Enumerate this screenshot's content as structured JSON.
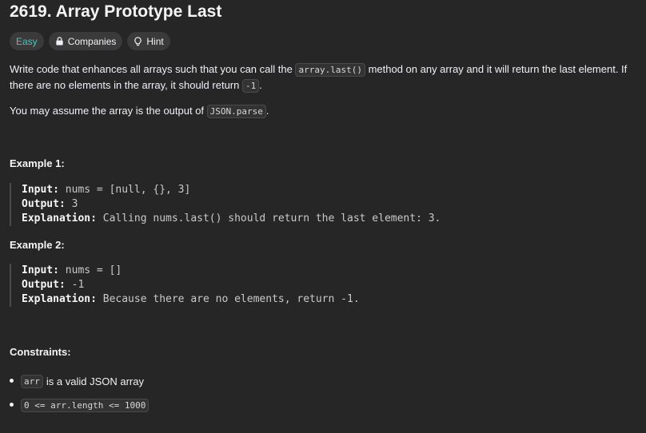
{
  "problem": {
    "title": "2619. Array Prototype Last"
  },
  "tags": {
    "difficulty": "Easy",
    "companies": "Companies",
    "hint": "Hint"
  },
  "description": {
    "p1_before": "Write code that enhances all arrays such that you can call the ",
    "p1_code": "array.last()",
    "p1_mid": " method on any array and it will return the last element. If there are no elements in the array, it should return ",
    "p1_code2": "-1",
    "p1_end": ".",
    "p2_before": "You may assume the array is the output of ",
    "p2_code": "JSON.parse",
    "p2_end": "."
  },
  "examples": [
    {
      "heading": "Example 1:",
      "input_label": "Input:",
      "input_value": " nums = [null, {}, 3]",
      "output_label": "Output:",
      "output_value": " 3",
      "explanation_label": "Explanation:",
      "explanation_value": " Calling nums.last() should return the last element: 3."
    },
    {
      "heading": "Example 2:",
      "input_label": "Input:",
      "input_value": " nums = []",
      "output_label": "Output:",
      "output_value": " -1",
      "explanation_label": "Explanation:",
      "explanation_value": " Because there are no elements, return -1."
    }
  ],
  "constraints": {
    "heading": "Constraints:",
    "items": [
      {
        "code": "arr",
        "text": "is a valid JSON array"
      },
      {
        "code": "0 <= arr.length <= 1000",
        "text": ""
      }
    ]
  },
  "colors": {
    "background": "#262626",
    "easy": "#46c6c2",
    "tag_bg": "#3a3a3a"
  }
}
